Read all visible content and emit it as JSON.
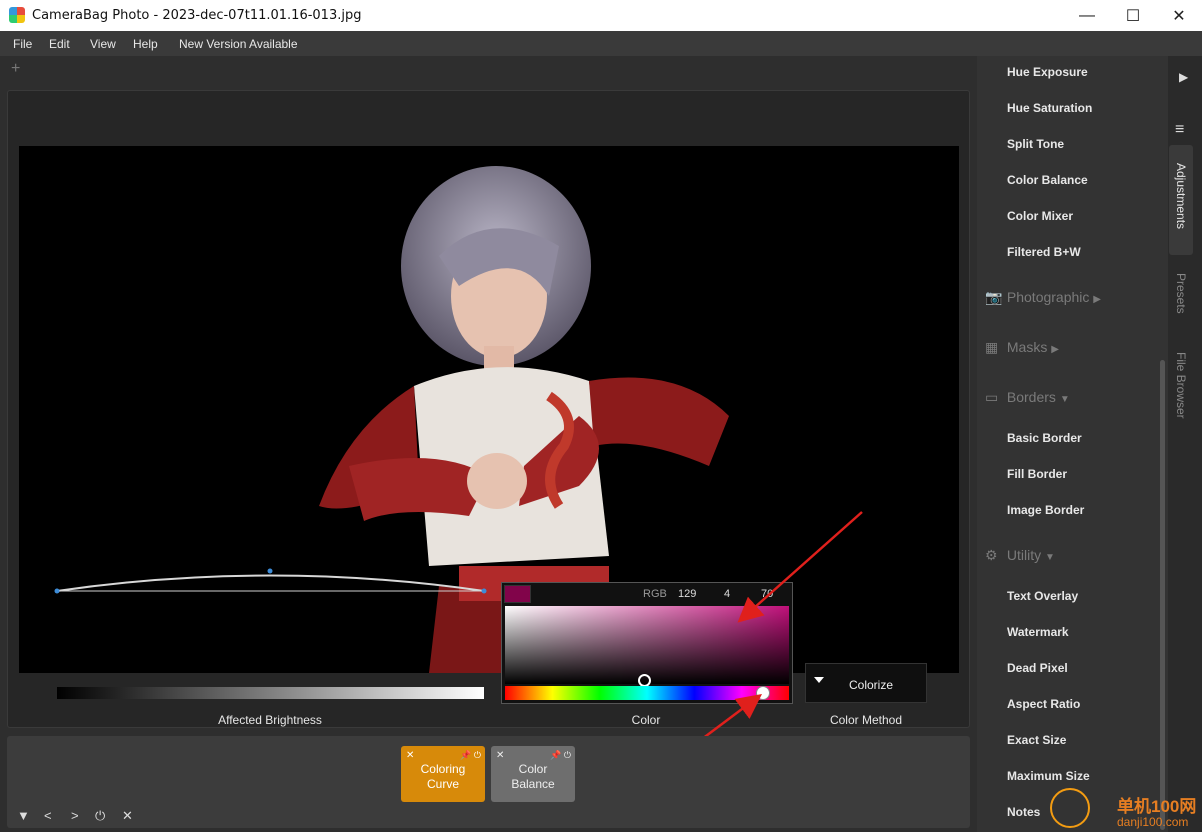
{
  "window": {
    "title": "CameraBag Photo - 2023-dec-07t11.01.16-013.jpg",
    "minimize": "—",
    "maximize": "☐",
    "close": "✕"
  },
  "menu": [
    "File",
    "Edit",
    "View",
    "Help",
    "New Version Available"
  ],
  "editor": {
    "add_tab": "+",
    "affected_brightness_label": "Affected Brightness",
    "color_label": "Color",
    "color_method_label": "Color Method",
    "color_method_value": "Colorize"
  },
  "color_picker": {
    "mode": "RGB",
    "r": "129",
    "g": "4",
    "b": "70",
    "swatch_color": "#81044a",
    "hue_level": 0.91
  },
  "cards": [
    {
      "label_line1": "Coloring",
      "label_line2": "Curve",
      "close": "✕",
      "pin": "📌 ⏻",
      "active": true
    },
    {
      "label_line1": "Color",
      "label_line2": "Balance",
      "close": "✕",
      "pin": "📌 ⏻",
      "active": false
    }
  ],
  "bottom_controls": [
    "▼",
    "<",
    ">",
    "⏻",
    "✕"
  ],
  "adjustments": {
    "items_top": [
      "Hue Exposure",
      "Hue Saturation",
      "Split Tone",
      "Color Balance",
      "Color Mixer",
      "Filtered B+W"
    ],
    "sections": [
      {
        "label": "Photographic",
        "icon": "📷",
        "arrow": "▶"
      },
      {
        "label": "Masks",
        "icon": "▦",
        "arrow": "▶"
      },
      {
        "label": "Borders",
        "icon": "▭",
        "arrow": "▼"
      },
      {
        "label": "Utility",
        "icon": "⚙",
        "arrow": "▼"
      }
    ],
    "borders_items": [
      "Basic Border",
      "Fill Border",
      "Image Border"
    ],
    "utility_items": [
      "Text Overlay",
      "Watermark",
      "Dead Pixel",
      "Aspect Ratio",
      "Exact Size",
      "Maximum Size",
      "Notes"
    ]
  },
  "side_tabs": {
    "play": "▶",
    "menu": "≡",
    "adjustments": "Adjustments",
    "presets": "Presets",
    "file_browser": "File Browser"
  },
  "watermark": {
    "line1": "单机100网",
    "line2": "danji100.com"
  },
  "colors": {
    "accent_card": "#d78a0a",
    "inactive_card": "#6e6e6e",
    "annotation": "#e0201c"
  }
}
